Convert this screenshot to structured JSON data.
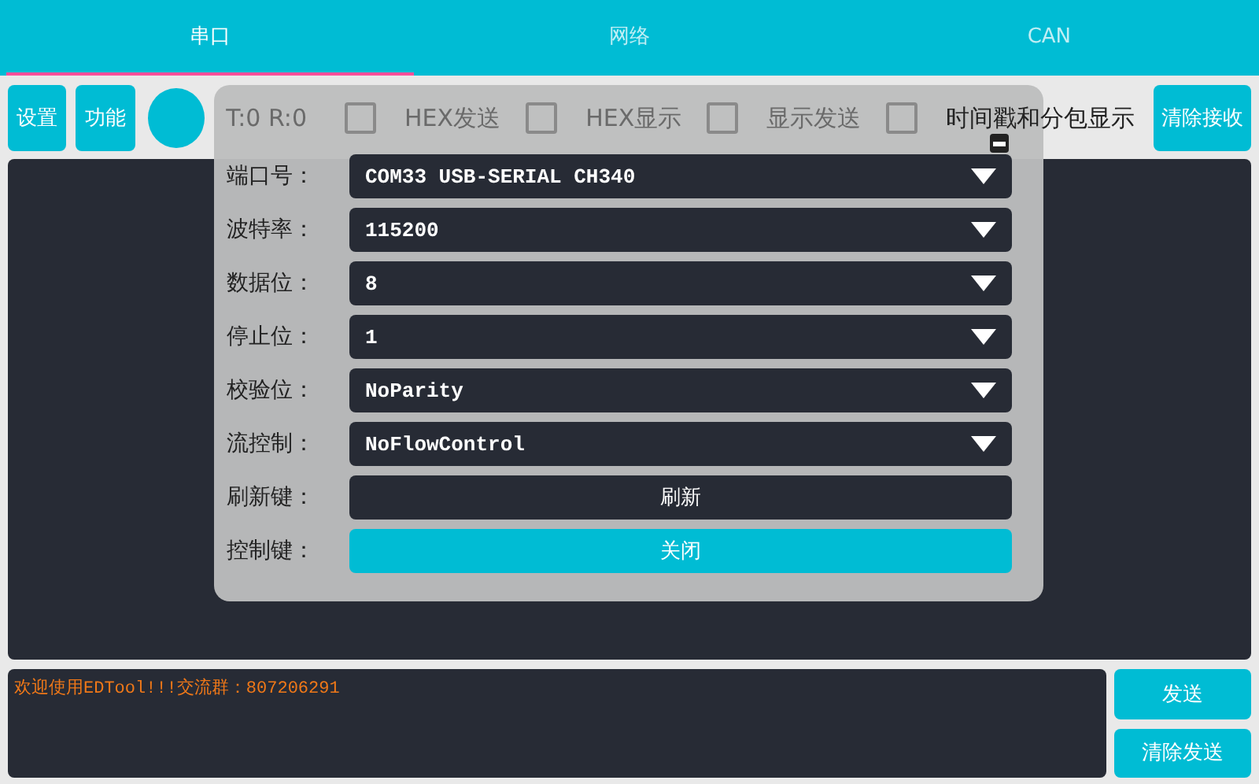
{
  "tabs": [
    {
      "label": "串口",
      "selected": true
    },
    {
      "label": "网络",
      "selected": false
    },
    {
      "label": "CAN",
      "selected": false
    }
  ],
  "toolbar": {
    "buttons": [
      "设置",
      "功能"
    ],
    "counter": "T:0  R:0",
    "checkboxes": [
      {
        "label": "HEX发送",
        "checked": false
      },
      {
        "label": "HEX显示",
        "checked": false
      },
      {
        "label": "显示发送",
        "checked": false
      },
      {
        "label": "时间戳和分包显示",
        "checked": false
      }
    ],
    "clear_button": "清除接收"
  },
  "dialog": {
    "rows": [
      {
        "label": "端口号：",
        "kind": "select",
        "value": "COM33 USB-SERIAL CH340"
      },
      {
        "label": "波特率：",
        "kind": "select",
        "value": "115200"
      },
      {
        "label": "数据位：",
        "kind": "select",
        "value": "8"
      },
      {
        "label": "停止位：",
        "kind": "select",
        "value": "1"
      },
      {
        "label": "校验位：",
        "kind": "select",
        "value": "NoParity"
      },
      {
        "label": "流控制：",
        "kind": "select",
        "value": "NoFlowControl"
      },
      {
        "label": "刷新键：",
        "kind": "button",
        "value": "刷新"
      },
      {
        "label": "控制键：",
        "kind": "accent",
        "value": "关闭"
      }
    ]
  },
  "send": {
    "value": "欢迎使用EDTool!!!交流群：807206291",
    "buttons": [
      "发送",
      "清除发送"
    ]
  }
}
